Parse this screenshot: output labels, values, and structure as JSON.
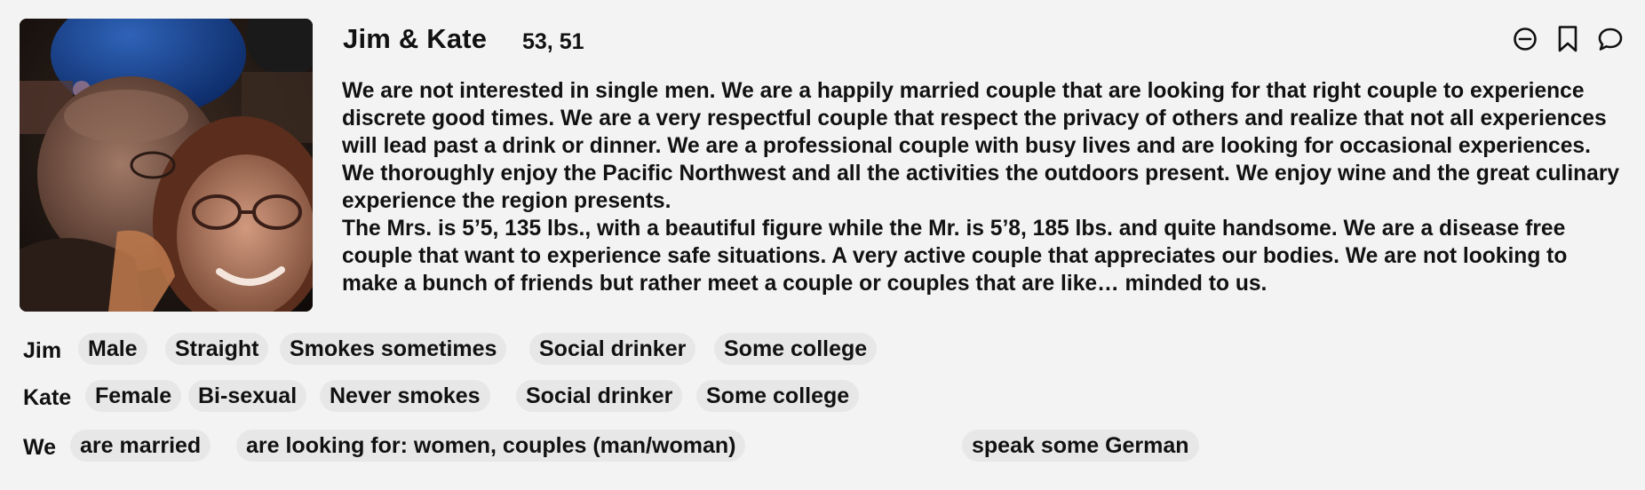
{
  "profile": {
    "name": "Jim & Kate",
    "ages": "53, 51",
    "bio_paragraphs": [
      "We are not interested in single men. We are a happily married couple that are looking for that right couple to experience discrete good times. We are a very respectful couple that respect the privacy of others and realize that not all experiences will lead past a drink or dinner. We are a professional couple with busy lives and are looking for occasional experiences. We thoroughly enjoy the Pacific Northwest and all the activities the outdoors present. We enjoy wine and the great culinary experience the region presents.",
      "The Mrs. is 5’5, 135 lbs., with a beautiful figure while the Mr. is 5’8, 185 lbs. and quite handsome. We are a disease free couple that want to experience safe situations. A very active couple that appreciates our bodies. We are not looking to make a bunch of friends but rather meet a couple or couples that are like… minded to us."
    ]
  },
  "actions": {
    "icons": [
      "hide-icon",
      "bookmark-icon",
      "message-icon"
    ]
  },
  "attributes": {
    "jim": {
      "label": "Jim",
      "tags": [
        "Male",
        "Straight",
        "Smokes sometimes",
        "Social drinker",
        "Some college"
      ]
    },
    "kate": {
      "label": "Kate",
      "tags": [
        "Female",
        "Bi-sexual",
        "Never smokes",
        "Social drinker",
        "Some college"
      ]
    },
    "we": {
      "label": "We",
      "tags": [
        "are married",
        "are looking for: women, couples (man/woman)",
        "speak some German"
      ]
    }
  },
  "colors": {
    "background": "#f3f3f3",
    "chip": "#e7e7e7",
    "text": "#111111"
  }
}
